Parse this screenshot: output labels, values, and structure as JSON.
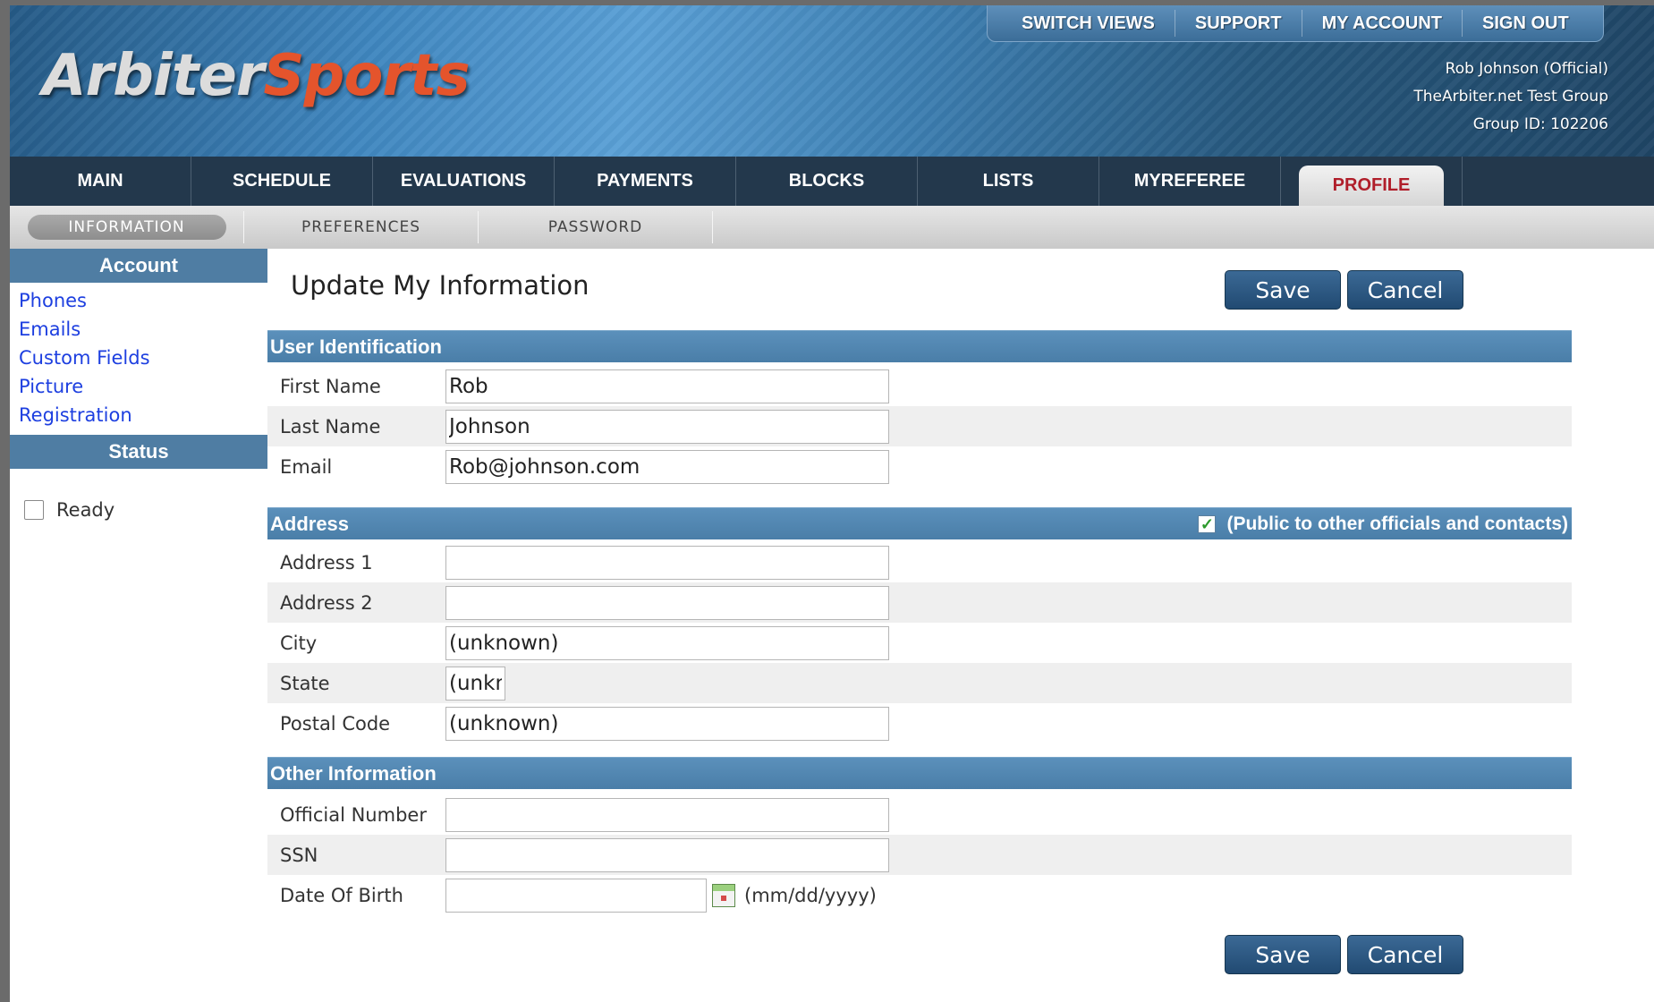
{
  "brand": {
    "logo_part1": "Arbiter",
    "logo_part2": "Sports",
    "brand_color": "#e4542c"
  },
  "topnav": {
    "items": [
      "SWITCH VIEWS",
      "SUPPORT",
      "MY ACCOUNT",
      "SIGN OUT"
    ]
  },
  "user": {
    "name_role": "Rob Johnson (Official)",
    "group_name": "TheArbiter.net Test Group",
    "group_id": "Group ID: 102206"
  },
  "main_tabs": {
    "items": [
      "MAIN",
      "SCHEDULE",
      "EVALUATIONS",
      "PAYMENTS",
      "BLOCKS",
      "LISTS",
      "MYREFEREE",
      "PROFILE"
    ],
    "active": "PROFILE",
    "active_color": "#b01e2a"
  },
  "sub_tabs": {
    "items": [
      "INFORMATION",
      "PREFERENCES",
      "PASSWORD"
    ],
    "active": "INFORMATION"
  },
  "sidebar": {
    "account_header": "Account",
    "links": [
      "Phones",
      "Emails",
      "Custom Fields",
      "Picture",
      "Registration"
    ],
    "status_header": "Status",
    "ready_label": "Ready",
    "ready_checked": false
  },
  "page": {
    "title": "Update My Information",
    "save_label": "Save",
    "cancel_label": "Cancel"
  },
  "sections": {
    "user_identification": {
      "header": "User Identification",
      "fields": [
        {
          "label": "First Name",
          "value": "Rob"
        },
        {
          "label": "Last Name",
          "value": "Johnson"
        },
        {
          "label": "Email",
          "value": "Rob@johnson.com"
        }
      ]
    },
    "address": {
      "header": "Address",
      "public_label": "(Public to other officials and contacts)",
      "public_checked": true,
      "fields": [
        {
          "label": "Address 1",
          "value": ""
        },
        {
          "label": "Address 2",
          "value": ""
        },
        {
          "label": "City",
          "value": "(unknown)"
        },
        {
          "label": "State",
          "value": "(unknown)"
        },
        {
          "label": "Postal Code",
          "value": "(unknown)"
        }
      ]
    },
    "other": {
      "header": "Other Information",
      "fields": [
        {
          "label": "Official Number",
          "value": ""
        },
        {
          "label": "SSN",
          "value": ""
        },
        {
          "label": "Date Of Birth",
          "value": ""
        }
      ],
      "dob_hint": "(mm/dd/yyyy)"
    }
  }
}
